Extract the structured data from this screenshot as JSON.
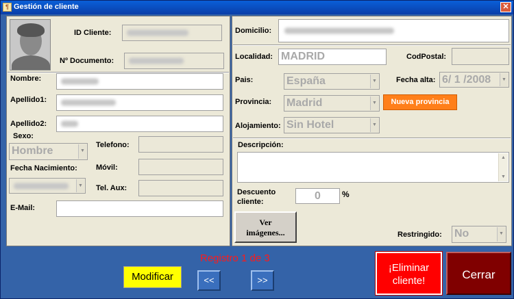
{
  "window": {
    "title": "Gestión de cliente",
    "close_glyph": "✕",
    "icon_glyph": "¶"
  },
  "left": {
    "id_cliente_label": "ID Cliente:",
    "id_cliente_value": "",
    "documento_label": "Nº Documento:",
    "documento_value": "",
    "nombre_label": "Nombre:",
    "nombre_value": "",
    "apellido1_label": "Apellido1:",
    "apellido1_value": "",
    "apellido2_label": "Apellido2:",
    "apellido2_value": "",
    "sexo_label": "Sexo:",
    "sexo_value": "Hombre",
    "telefono_label": "Telefono:",
    "telefono_value": "",
    "fecha_nac_label": "Fecha Nacimiento:",
    "fecha_nac_value": "",
    "movil_label": "Móvil:",
    "movil_value": "",
    "tel_aux_label": "Tel. Aux:",
    "tel_aux_value": "",
    "email_label": "E-Mail:",
    "email_value": ""
  },
  "right": {
    "domicilio_label": "Domicilio:",
    "domicilio_value": "",
    "localidad_label": "Localidad:",
    "localidad_value": "MADRID",
    "codpostal_label": "CodPostal:",
    "codpostal_value": "",
    "pais_label": "Pais:",
    "pais_value": "España",
    "fecha_alta_label": "Fecha alta:",
    "fecha_alta_value": "6/ 1 /2008",
    "provincia_label": "Provincia:",
    "provincia_value": "Madrid",
    "nueva_provincia_label": "Nueva provincia",
    "alojamiento_label": "Alojamiento:",
    "alojamiento_value": "Sin Hotel",
    "descripcion_label": "Descripción:",
    "descripcion_value": "",
    "descuento_label_line1": "Descuento",
    "descuento_label_line2": "cliente:",
    "descuento_value": "0",
    "percent_sign": "%",
    "ver_imagenes_line1": "Ver",
    "ver_imagenes_line2": "imágenes...",
    "restringido_label": "Restringido:",
    "restringido_value": "No"
  },
  "bottom": {
    "modificar_label": "Modificar",
    "registro_text": "Registro 1 de 3",
    "prev_label": "<<",
    "next_label": ">>",
    "eliminar_line1": "¡Eliminar",
    "eliminar_line2": "cliente!",
    "cerrar_label": "Cerrar"
  },
  "colors": {
    "window_bg": "#3463a8",
    "panel_bg": "#ece9d8",
    "nueva_provincia": "#ff7f1a",
    "modificar": "#ffff00",
    "eliminar": "#ff0000",
    "cerrar": "#800000",
    "registro_text": "#ff1a1a"
  },
  "icons": {
    "dropdown": "dropdown-arrow-icon",
    "close": "close-icon",
    "app": "app-icon",
    "photo": "customer-photo"
  }
}
